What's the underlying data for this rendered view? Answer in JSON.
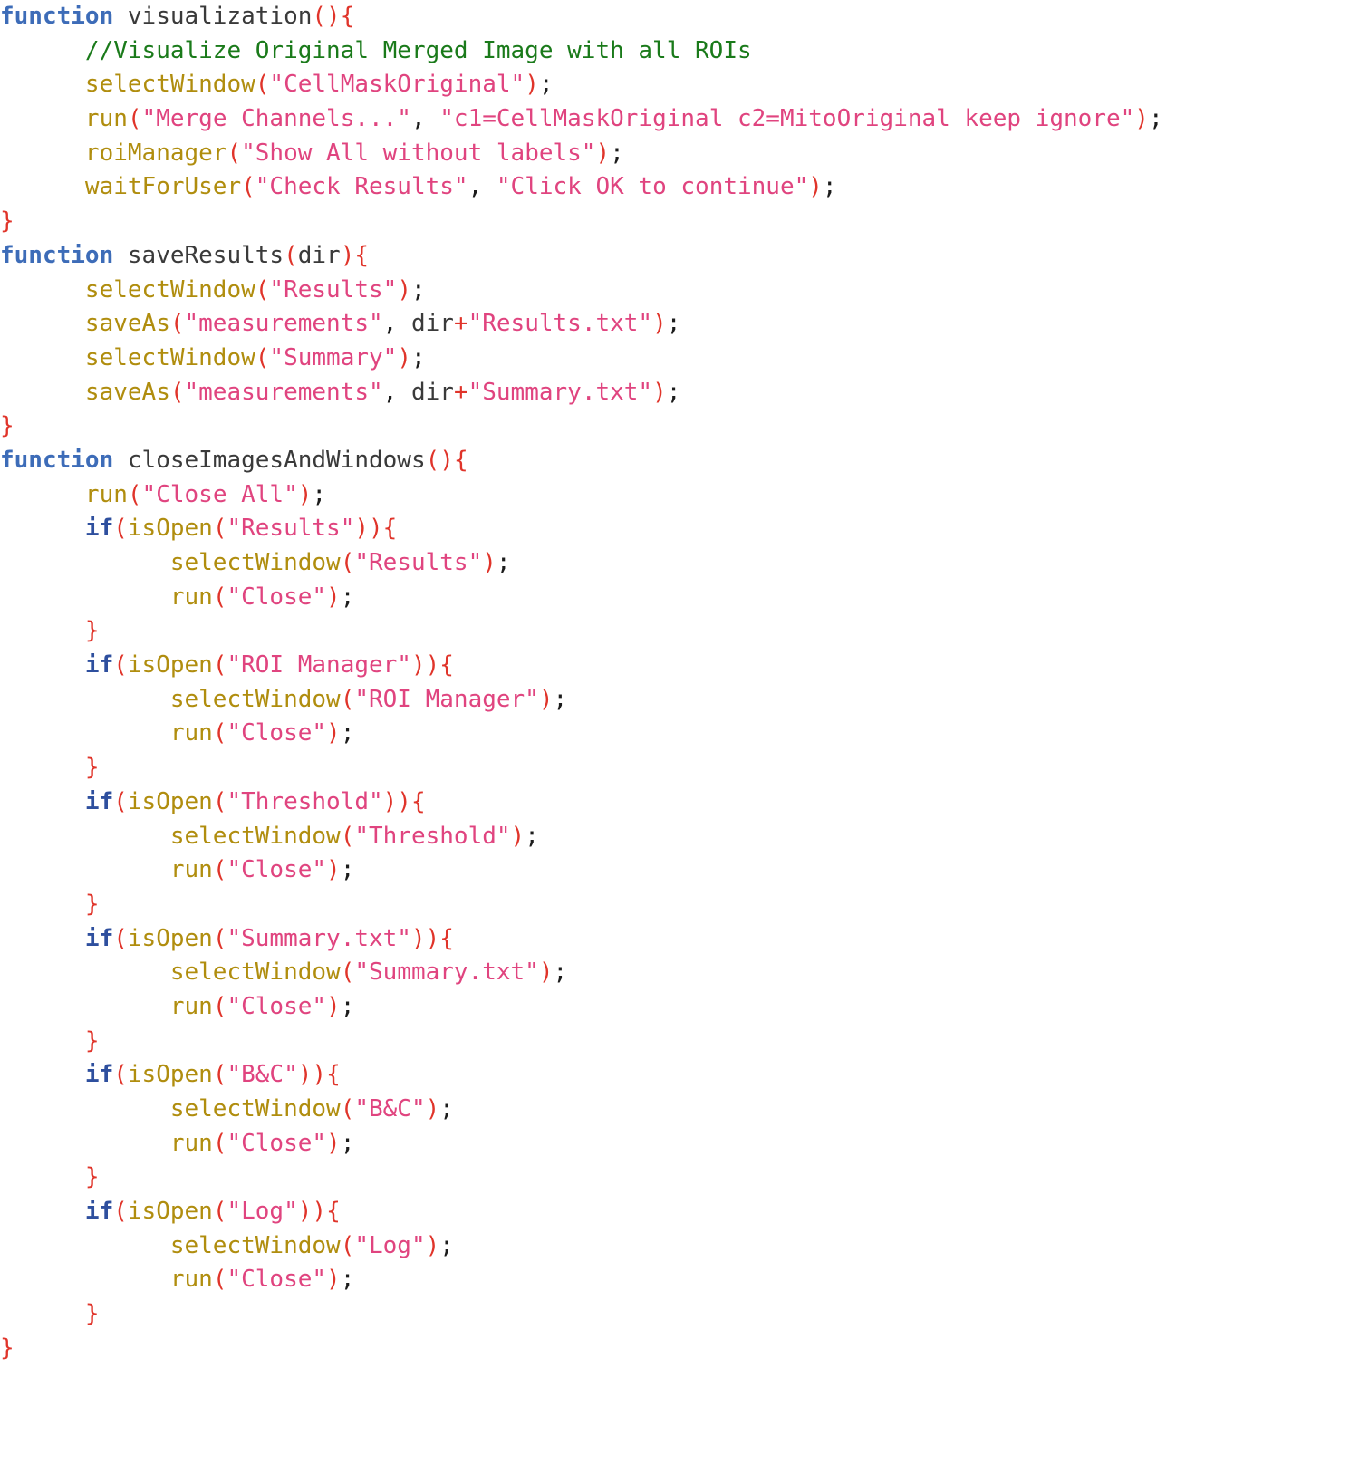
{
  "document": {
    "kind": "source-code-listing",
    "language": "ImageJ Macro (IJM)",
    "background_color": "#ffffff",
    "font_size_px": 26,
    "line_height_px": 37.7,
    "indent_spaces_per_level": 6
  },
  "theme": {
    "keyword_color": "#3d6cb8",
    "keyword_if_color": "#2e4f9e",
    "identifier_color": "#3a3a3a",
    "function_call_color": "#b08d0e",
    "string_color": "#e0447f",
    "comment_color": "#1a7a1a",
    "punctuation_color": "#e0342a",
    "semicolon_color": "#1c1c1c"
  },
  "code": {
    "lines": [
      {
        "id": "line-1",
        "indent": 0,
        "tokens": [
          {
            "t": "kw",
            "v": "function"
          },
          {
            "t": "plain",
            "v": " "
          },
          {
            "t": "id",
            "v": "visualization"
          },
          {
            "t": "pun",
            "v": "()"
          },
          {
            "t": "brace",
            "v": "{"
          }
        ]
      },
      {
        "id": "line-2",
        "indent": 1,
        "tokens": [
          {
            "t": "com",
            "v": "//Visualize Original Merged Image with all ROIs"
          }
        ]
      },
      {
        "id": "line-3",
        "indent": 1,
        "tokens": [
          {
            "t": "fn",
            "v": "selectWindow"
          },
          {
            "t": "pun",
            "v": "("
          },
          {
            "t": "str",
            "v": "\"CellMaskOriginal\""
          },
          {
            "t": "pun",
            "v": ")"
          },
          {
            "t": "semi",
            "v": ";"
          }
        ]
      },
      {
        "id": "line-4",
        "indent": 1,
        "wrapped": true,
        "tokens": [
          {
            "t": "fn",
            "v": "run"
          },
          {
            "t": "pun",
            "v": "("
          },
          {
            "t": "str",
            "v": "\"Merge Channels...\""
          },
          {
            "t": "semi",
            "v": ","
          },
          {
            "t": "plain",
            "v": " "
          },
          {
            "t": "str",
            "v": "\"c1=CellMaskOriginal c2=MitoOriginal keep ignore\""
          },
          {
            "t": "pun",
            "v": ")"
          },
          {
            "t": "semi",
            "v": ";"
          }
        ]
      },
      {
        "id": "line-5",
        "indent": 1,
        "tokens": [
          {
            "t": "fn",
            "v": "roiManager"
          },
          {
            "t": "pun",
            "v": "("
          },
          {
            "t": "str",
            "v": "\"Show All without labels\""
          },
          {
            "t": "pun",
            "v": ")"
          },
          {
            "t": "semi",
            "v": ";"
          }
        ]
      },
      {
        "id": "line-6",
        "indent": 1,
        "tokens": [
          {
            "t": "fn",
            "v": "waitForUser"
          },
          {
            "t": "pun",
            "v": "("
          },
          {
            "t": "str",
            "v": "\"Check Results\""
          },
          {
            "t": "semi",
            "v": ","
          },
          {
            "t": "plain",
            "v": " "
          },
          {
            "t": "str",
            "v": "\"Click OK to continue\""
          },
          {
            "t": "pun",
            "v": ")"
          },
          {
            "t": "semi",
            "v": ";"
          }
        ]
      },
      {
        "id": "line-7",
        "indent": 0,
        "tokens": [
          {
            "t": "brace",
            "v": "}"
          }
        ]
      },
      {
        "id": "line-8",
        "indent": 0,
        "tokens": [
          {
            "t": "kw",
            "v": "function"
          },
          {
            "t": "plain",
            "v": " "
          },
          {
            "t": "id",
            "v": "saveResults"
          },
          {
            "t": "pun",
            "v": "("
          },
          {
            "t": "id",
            "v": "dir"
          },
          {
            "t": "pun",
            "v": ")"
          },
          {
            "t": "brace",
            "v": "{"
          }
        ]
      },
      {
        "id": "line-9",
        "indent": 1,
        "tokens": [
          {
            "t": "fn",
            "v": "selectWindow"
          },
          {
            "t": "pun",
            "v": "("
          },
          {
            "t": "str",
            "v": "\"Results\""
          },
          {
            "t": "pun",
            "v": ")"
          },
          {
            "t": "semi",
            "v": ";"
          }
        ]
      },
      {
        "id": "line-10",
        "indent": 1,
        "tokens": [
          {
            "t": "fn",
            "v": "saveAs"
          },
          {
            "t": "pun",
            "v": "("
          },
          {
            "t": "str",
            "v": "\"measurements\""
          },
          {
            "t": "semi",
            "v": ","
          },
          {
            "t": "plain",
            "v": " "
          },
          {
            "t": "id",
            "v": "dir"
          },
          {
            "t": "op",
            "v": "+"
          },
          {
            "t": "str",
            "v": "\"Results.txt\""
          },
          {
            "t": "pun",
            "v": ")"
          },
          {
            "t": "semi",
            "v": ";"
          }
        ]
      },
      {
        "id": "line-11",
        "indent": 1,
        "tokens": [
          {
            "t": "fn",
            "v": "selectWindow"
          },
          {
            "t": "pun",
            "v": "("
          },
          {
            "t": "str",
            "v": "\"Summary\""
          },
          {
            "t": "pun",
            "v": ")"
          },
          {
            "t": "semi",
            "v": ";"
          }
        ]
      },
      {
        "id": "line-12",
        "indent": 1,
        "tokens": [
          {
            "t": "fn",
            "v": "saveAs"
          },
          {
            "t": "pun",
            "v": "("
          },
          {
            "t": "str",
            "v": "\"measurements\""
          },
          {
            "t": "semi",
            "v": ","
          },
          {
            "t": "plain",
            "v": " "
          },
          {
            "t": "id",
            "v": "dir"
          },
          {
            "t": "op",
            "v": "+"
          },
          {
            "t": "str",
            "v": "\"Summary.txt\""
          },
          {
            "t": "pun",
            "v": ")"
          },
          {
            "t": "semi",
            "v": ";"
          }
        ]
      },
      {
        "id": "line-13",
        "indent": 0,
        "tokens": [
          {
            "t": "brace",
            "v": "}"
          }
        ]
      },
      {
        "id": "line-14",
        "indent": 0,
        "tokens": [
          {
            "t": "kw",
            "v": "function"
          },
          {
            "t": "plain",
            "v": " "
          },
          {
            "t": "id",
            "v": "closeImagesAndWindows"
          },
          {
            "t": "pun",
            "v": "()"
          },
          {
            "t": "brace",
            "v": "{"
          }
        ]
      },
      {
        "id": "line-15",
        "indent": 1,
        "tokens": [
          {
            "t": "fn",
            "v": "run"
          },
          {
            "t": "pun",
            "v": "("
          },
          {
            "t": "str",
            "v": "\"Close All\""
          },
          {
            "t": "pun",
            "v": ")"
          },
          {
            "t": "semi",
            "v": ";"
          }
        ]
      },
      {
        "id": "line-16",
        "indent": 1,
        "tokens": [
          {
            "t": "kw-if",
            "v": "if"
          },
          {
            "t": "pun",
            "v": "("
          },
          {
            "t": "fn",
            "v": "isOpen"
          },
          {
            "t": "pun",
            "v": "("
          },
          {
            "t": "str",
            "v": "\"Results\""
          },
          {
            "t": "pun",
            "v": "))"
          },
          {
            "t": "brace",
            "v": "{"
          }
        ]
      },
      {
        "id": "line-17",
        "indent": 2,
        "tokens": [
          {
            "t": "fn",
            "v": "selectWindow"
          },
          {
            "t": "pun",
            "v": "("
          },
          {
            "t": "str",
            "v": "\"Results\""
          },
          {
            "t": "pun",
            "v": ")"
          },
          {
            "t": "semi",
            "v": ";"
          }
        ]
      },
      {
        "id": "line-18",
        "indent": 2,
        "tokens": [
          {
            "t": "fn",
            "v": "run"
          },
          {
            "t": "pun",
            "v": "("
          },
          {
            "t": "str",
            "v": "\"Close\""
          },
          {
            "t": "pun",
            "v": ")"
          },
          {
            "t": "semi",
            "v": ";"
          }
        ]
      },
      {
        "id": "line-19",
        "indent": 1,
        "tokens": [
          {
            "t": "brace",
            "v": "}"
          }
        ]
      },
      {
        "id": "line-20",
        "indent": 1,
        "tokens": [
          {
            "t": "kw-if",
            "v": "if"
          },
          {
            "t": "pun",
            "v": "("
          },
          {
            "t": "fn",
            "v": "isOpen"
          },
          {
            "t": "pun",
            "v": "("
          },
          {
            "t": "str",
            "v": "\"ROI Manager\""
          },
          {
            "t": "pun",
            "v": "))"
          },
          {
            "t": "brace",
            "v": "{"
          }
        ]
      },
      {
        "id": "line-21",
        "indent": 2,
        "tokens": [
          {
            "t": "fn",
            "v": "selectWindow"
          },
          {
            "t": "pun",
            "v": "("
          },
          {
            "t": "str",
            "v": "\"ROI Manager\""
          },
          {
            "t": "pun",
            "v": ")"
          },
          {
            "t": "semi",
            "v": ";"
          }
        ]
      },
      {
        "id": "line-22",
        "indent": 2,
        "tokens": [
          {
            "t": "fn",
            "v": "run"
          },
          {
            "t": "pun",
            "v": "("
          },
          {
            "t": "str",
            "v": "\"Close\""
          },
          {
            "t": "pun",
            "v": ")"
          },
          {
            "t": "semi",
            "v": ";"
          }
        ]
      },
      {
        "id": "line-23",
        "indent": 1,
        "tokens": [
          {
            "t": "brace",
            "v": "}"
          }
        ]
      },
      {
        "id": "line-24",
        "indent": 1,
        "tokens": [
          {
            "t": "kw-if",
            "v": "if"
          },
          {
            "t": "pun",
            "v": "("
          },
          {
            "t": "fn",
            "v": "isOpen"
          },
          {
            "t": "pun",
            "v": "("
          },
          {
            "t": "str",
            "v": "\"Threshold\""
          },
          {
            "t": "pun",
            "v": "))"
          },
          {
            "t": "brace",
            "v": "{"
          }
        ]
      },
      {
        "id": "line-25",
        "indent": 2,
        "tokens": [
          {
            "t": "fn",
            "v": "selectWindow"
          },
          {
            "t": "pun",
            "v": "("
          },
          {
            "t": "str",
            "v": "\"Threshold\""
          },
          {
            "t": "pun",
            "v": ")"
          },
          {
            "t": "semi",
            "v": ";"
          }
        ]
      },
      {
        "id": "line-26",
        "indent": 2,
        "tokens": [
          {
            "t": "fn",
            "v": "run"
          },
          {
            "t": "pun",
            "v": "("
          },
          {
            "t": "str",
            "v": "\"Close\""
          },
          {
            "t": "pun",
            "v": ")"
          },
          {
            "t": "semi",
            "v": ";"
          }
        ]
      },
      {
        "id": "line-27",
        "indent": 1,
        "tokens": [
          {
            "t": "brace",
            "v": "}"
          }
        ]
      },
      {
        "id": "line-28",
        "indent": 1,
        "tokens": [
          {
            "t": "kw-if",
            "v": "if"
          },
          {
            "t": "pun",
            "v": "("
          },
          {
            "t": "fn",
            "v": "isOpen"
          },
          {
            "t": "pun",
            "v": "("
          },
          {
            "t": "str",
            "v": "\"Summary.txt\""
          },
          {
            "t": "pun",
            "v": "))"
          },
          {
            "t": "brace",
            "v": "{"
          }
        ]
      },
      {
        "id": "line-29",
        "indent": 2,
        "tokens": [
          {
            "t": "fn",
            "v": "selectWindow"
          },
          {
            "t": "pun",
            "v": "("
          },
          {
            "t": "str",
            "v": "\"Summary.txt\""
          },
          {
            "t": "pun",
            "v": ")"
          },
          {
            "t": "semi",
            "v": ";"
          }
        ]
      },
      {
        "id": "line-30",
        "indent": 2,
        "tokens": [
          {
            "t": "fn",
            "v": "run"
          },
          {
            "t": "pun",
            "v": "("
          },
          {
            "t": "str",
            "v": "\"Close\""
          },
          {
            "t": "pun",
            "v": ")"
          },
          {
            "t": "semi",
            "v": ";"
          }
        ]
      },
      {
        "id": "line-31",
        "indent": 1,
        "tokens": [
          {
            "t": "brace",
            "v": "}"
          }
        ]
      },
      {
        "id": "line-32",
        "indent": 1,
        "tokens": [
          {
            "t": "kw-if",
            "v": "if"
          },
          {
            "t": "pun",
            "v": "("
          },
          {
            "t": "fn",
            "v": "isOpen"
          },
          {
            "t": "pun",
            "v": "("
          },
          {
            "t": "str",
            "v": "\"B&C\""
          },
          {
            "t": "pun",
            "v": "))"
          },
          {
            "t": "brace",
            "v": "{"
          }
        ]
      },
      {
        "id": "line-33",
        "indent": 2,
        "tokens": [
          {
            "t": "fn",
            "v": "selectWindow"
          },
          {
            "t": "pun",
            "v": "("
          },
          {
            "t": "str",
            "v": "\"B&C\""
          },
          {
            "t": "pun",
            "v": ")"
          },
          {
            "t": "semi",
            "v": ";"
          }
        ]
      },
      {
        "id": "line-34",
        "indent": 2,
        "tokens": [
          {
            "t": "fn",
            "v": "run"
          },
          {
            "t": "pun",
            "v": "("
          },
          {
            "t": "str",
            "v": "\"Close\""
          },
          {
            "t": "pun",
            "v": ")"
          },
          {
            "t": "semi",
            "v": ";"
          }
        ]
      },
      {
        "id": "line-35",
        "indent": 1,
        "tokens": [
          {
            "t": "brace",
            "v": "}"
          }
        ]
      },
      {
        "id": "line-36",
        "indent": 1,
        "tokens": [
          {
            "t": "kw-if",
            "v": "if"
          },
          {
            "t": "pun",
            "v": "("
          },
          {
            "t": "fn",
            "v": "isOpen"
          },
          {
            "t": "pun",
            "v": "("
          },
          {
            "t": "str",
            "v": "\"Log\""
          },
          {
            "t": "pun",
            "v": "))"
          },
          {
            "t": "brace",
            "v": "{"
          }
        ]
      },
      {
        "id": "line-37",
        "indent": 2,
        "tokens": [
          {
            "t": "fn",
            "v": "selectWindow"
          },
          {
            "t": "pun",
            "v": "("
          },
          {
            "t": "str",
            "v": "\"Log\""
          },
          {
            "t": "pun",
            "v": ")"
          },
          {
            "t": "semi",
            "v": ";"
          }
        ]
      },
      {
        "id": "line-38",
        "indent": 2,
        "tokens": [
          {
            "t": "fn",
            "v": "run"
          },
          {
            "t": "pun",
            "v": "("
          },
          {
            "t": "str",
            "v": "\"Close\""
          },
          {
            "t": "pun",
            "v": ")"
          },
          {
            "t": "semi",
            "v": ";"
          }
        ]
      },
      {
        "id": "line-39",
        "indent": 1,
        "tokens": [
          {
            "t": "brace",
            "v": "}"
          }
        ]
      },
      {
        "id": "line-40",
        "indent": 0,
        "tokens": [
          {
            "t": "brace",
            "v": "}"
          }
        ]
      }
    ]
  }
}
